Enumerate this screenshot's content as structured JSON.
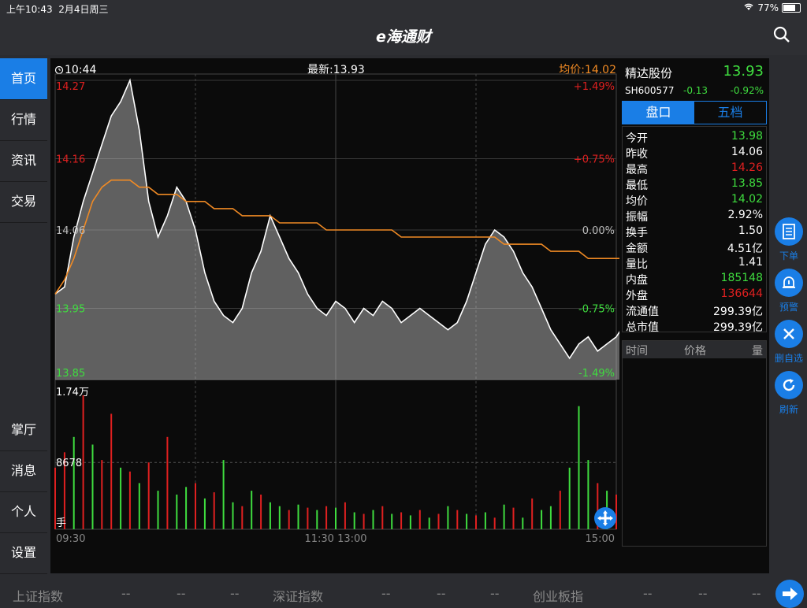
{
  "status_bar": {
    "time": "上午10:43",
    "date": "2月4日周三",
    "battery": "77%",
    "battery_level": 0.77
  },
  "app": {
    "title": "e海通财"
  },
  "sidebar": {
    "top_items": [
      {
        "label": "首页",
        "active": true
      },
      {
        "label": "行情"
      },
      {
        "label": "资讯"
      },
      {
        "label": "交易"
      }
    ],
    "bottom_items": [
      {
        "label": "掌厅"
      },
      {
        "label": "消息"
      },
      {
        "label": "个人"
      },
      {
        "label": "设置"
      }
    ]
  },
  "chart_header": {
    "time": "10:44",
    "latest": "最新:13.93",
    "avg": "均价:14.02"
  },
  "chart_data": {
    "type": "line",
    "title": "",
    "price_levels": [
      14.27,
      14.16,
      14.06,
      13.95,
      13.85
    ],
    "price_labels": [
      "14.27",
      "14.16",
      "14.06",
      "13.95",
      "13.85"
    ],
    "pct_labels": [
      "+1.49%",
      "+0.75%",
      "0.00%",
      "-0.75%",
      "-1.49%"
    ],
    "ylim": [
      13.85,
      14.27
    ],
    "x_ticks": [
      "09:30",
      "11:30 13:00",
      "15:00"
    ],
    "series": [
      {
        "name": "",
        "color": "#ffffff",
        "values": [
          13.97,
          13.98,
          14.05,
          14.1,
          14.14,
          14.18,
          14.22,
          14.24,
          14.27,
          14.2,
          14.1,
          14.05,
          14.08,
          14.12,
          14.1,
          14.06,
          14.0,
          13.96,
          13.94,
          13.93,
          13.95,
          14.0,
          14.03,
          14.08,
          14.05,
          14.02,
          14.0,
          13.97,
          13.95,
          13.94,
          13.96,
          13.95,
          13.93,
          13.95,
          13.94,
          13.96,
          13.95,
          13.93,
          13.94,
          13.95,
          13.94,
          13.93,
          13.92,
          13.93,
          13.96,
          14.0,
          14.04,
          14.06,
          14.05,
          14.03,
          14.0,
          13.98,
          13.95,
          13.92,
          13.9,
          13.88,
          13.9,
          13.91,
          13.89,
          13.9,
          13.91,
          13.93
        ]
      },
      {
        "name": "均价",
        "color": "#f08a24",
        "values": [
          13.97,
          13.99,
          14.02,
          14.06,
          14.1,
          14.12,
          14.13,
          14.13,
          14.13,
          14.12,
          14.12,
          14.11,
          14.11,
          14.11,
          14.1,
          14.1,
          14.1,
          14.09,
          14.09,
          14.09,
          14.08,
          14.08,
          14.08,
          14.08,
          14.07,
          14.07,
          14.07,
          14.07,
          14.07,
          14.06,
          14.06,
          14.06,
          14.06,
          14.06,
          14.06,
          14.06,
          14.06,
          14.05,
          14.05,
          14.05,
          14.05,
          14.05,
          14.05,
          14.05,
          14.05,
          14.05,
          14.05,
          14.05,
          14.04,
          14.04,
          14.04,
          14.04,
          14.04,
          14.03,
          14.03,
          14.03,
          14.03,
          14.02,
          14.02,
          14.02,
          14.02,
          14.02
        ]
      }
    ],
    "volume": {
      "max_label": "1.74万",
      "mid_label": "8678",
      "unit_label": "手",
      "max": 17400,
      "values": [
        8000,
        10000,
        12000,
        17400,
        11000,
        9000,
        15000,
        8000,
        7500,
        6000,
        8678,
        5000,
        12000,
        4500,
        5500,
        6000,
        4000,
        4800,
        9000,
        3500,
        3000,
        5000,
        4500,
        3500,
        3000,
        2500,
        3200,
        2800,
        2500,
        3000,
        2800,
        3500,
        2200,
        2000,
        2500,
        3000,
        2000,
        2200,
        1800,
        2500,
        1500,
        2000,
        3000,
        2500,
        2000,
        1800,
        2200,
        1500,
        3200,
        2800,
        1500,
        4000,
        2500,
        3000,
        5000,
        8000,
        16000,
        9000,
        6000,
        5000,
        4500,
        2000
      ],
      "colors": [
        "#e02020",
        "#e02020",
        "#3fdd3f",
        "#e02020",
        "#3fdd3f",
        "#e02020",
        "#e02020",
        "#3fdd3f",
        "#e02020",
        "#3fdd3f",
        "#e02020",
        "#3fdd3f",
        "#e02020",
        "#3fdd3f",
        "#3fdd3f",
        "#e02020",
        "#3fdd3f",
        "#e02020",
        "#3fdd3f",
        "#3fdd3f",
        "#e02020",
        "#3fdd3f",
        "#e02020",
        "#3fdd3f",
        "#3fdd3f",
        "#e02020",
        "#3fdd3f",
        "#e02020",
        "#3fdd3f",
        "#e02020",
        "#3fdd3f",
        "#e02020",
        "#3fdd3f",
        "#e02020",
        "#3fdd3f",
        "#e02020",
        "#3fdd3f",
        "#e02020",
        "#3fdd3f",
        "#e02020",
        "#3fdd3f",
        "#e02020",
        "#3fdd3f",
        "#e02020",
        "#3fdd3f",
        "#e02020",
        "#3fdd3f",
        "#e02020",
        "#3fdd3f",
        "#e02020",
        "#3fdd3f",
        "#e02020",
        "#3fdd3f",
        "#3fdd3f",
        "#e02020",
        "#3fdd3f",
        "#3fdd3f",
        "#3fdd3f",
        "#e02020",
        "#3fdd3f",
        "#e02020",
        "#e02020"
      ]
    }
  },
  "quote": {
    "name": "精达股份",
    "price": "13.93",
    "code": "SH600577",
    "change": "-0.13",
    "pct": "-0.92%",
    "tabs": [
      {
        "label": "盘口",
        "active": true
      },
      {
        "label": "五档"
      }
    ],
    "stats": [
      {
        "k": "今开",
        "v": "13.98",
        "color": "#3fdd3f"
      },
      {
        "k": "昨收",
        "v": "14.06",
        "color": "#ffffff"
      },
      {
        "k": "最高",
        "v": "14.26",
        "color": "#e02020"
      },
      {
        "k": "最低",
        "v": "13.85",
        "color": "#3fdd3f"
      },
      {
        "k": "均价",
        "v": "14.02",
        "color": "#3fdd3f"
      },
      {
        "k": "振幅",
        "v": "2.92%",
        "color": "#ffffff"
      },
      {
        "k": "换手",
        "v": "1.50",
        "color": "#ffffff"
      },
      {
        "k": "金额",
        "v": "4.51亿",
        "color": "#ffffff"
      },
      {
        "k": "量比",
        "v": "1.41",
        "color": "#ffffff"
      },
      {
        "k": "内盘",
        "v": "185148",
        "color": "#3fdd3f"
      },
      {
        "k": "外盘",
        "v": "136644",
        "color": "#e02020"
      },
      {
        "k": "流通值",
        "v": "299.39亿",
        "color": "#ffffff"
      },
      {
        "k": "总市值",
        "v": "299.39亿",
        "color": "#ffffff"
      }
    ],
    "trades_header": {
      "time": "时间",
      "price": "价格",
      "vol": "量"
    }
  },
  "right_rail": [
    {
      "label": "下单",
      "icon": "order-icon"
    },
    {
      "label": "预警",
      "icon": "bell-icon"
    },
    {
      "label": "删自选",
      "icon": "close-icon"
    },
    {
      "label": "刷新",
      "icon": "refresh-icon"
    }
  ],
  "bottom_bar": {
    "items": [
      {
        "name": "上证指数",
        "v1": "--",
        "v2": "--",
        "v3": "--"
      },
      {
        "name": "深证指数",
        "v1": "--",
        "v2": "--",
        "v3": "--"
      },
      {
        "name": "创业板指",
        "v1": "--",
        "v2": "--",
        "v3": "--"
      }
    ]
  }
}
